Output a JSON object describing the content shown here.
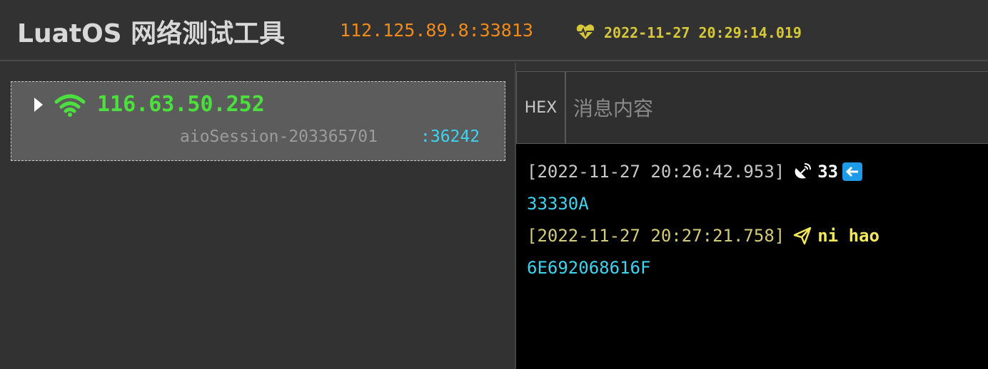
{
  "header": {
    "title": "LuatOS 网络测试工具",
    "server_address": "112.125.89.8:33813",
    "heartbeat_icon": "heart-pulse-icon",
    "heartbeat_time": "2022-11-27 20:29:14.019",
    "colors": {
      "server_address": "#f08a1c",
      "heartbeat": "#d6c83a"
    }
  },
  "clients": [
    {
      "ip": "116.63.50.252",
      "session": "aioSession-203365701",
      "port": ":36242",
      "status_icon": "wifi-icon"
    }
  ],
  "composer": {
    "hex_label": "HEX",
    "placeholder": "消息内容"
  },
  "log": [
    {
      "direction": "received",
      "timestamp": "[2022-11-27 20:26:42.953]",
      "icon": "satellite-dish-icon",
      "payload": "33",
      "badge_icon": "arrow-left-icon",
      "hex": "33330A"
    },
    {
      "direction": "sent",
      "timestamp": "[2022-11-27 20:27:21.758]",
      "icon": "paper-plane-icon",
      "payload": "ni hao",
      "hex": "6E692068616F"
    }
  ]
}
